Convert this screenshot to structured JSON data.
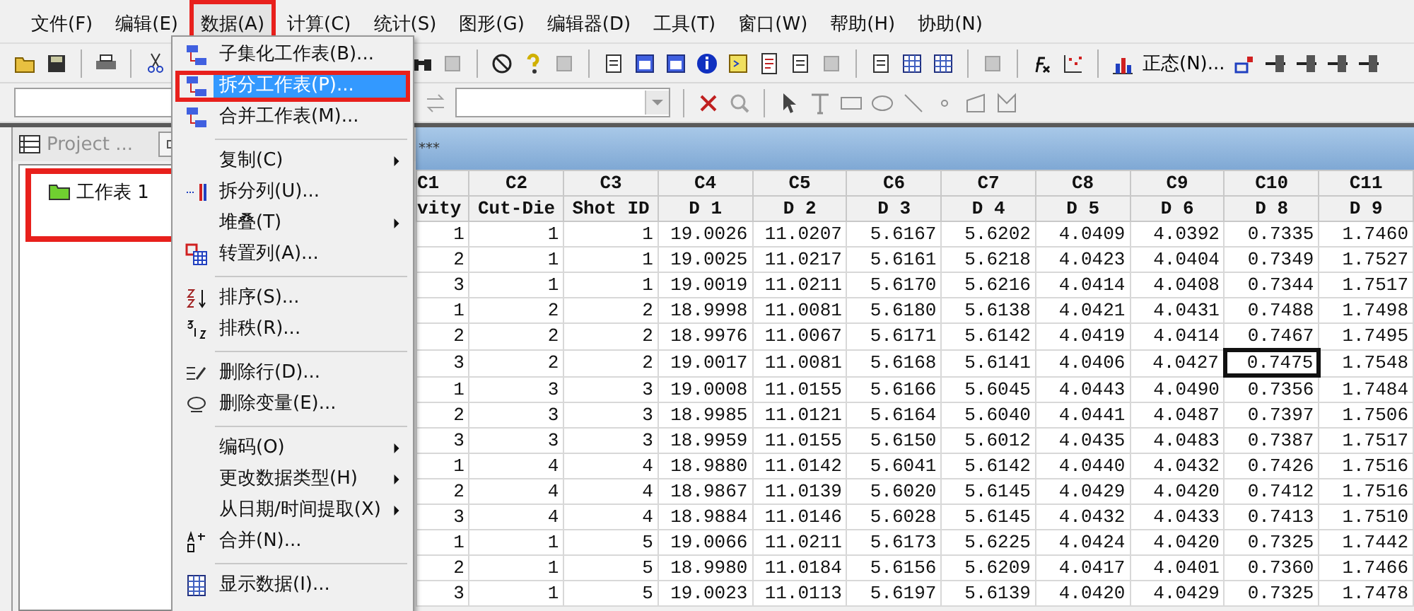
{
  "menu_bar": [
    {
      "label": "文件(F)",
      "selected": false,
      "highlighted": false
    },
    {
      "label": "编辑(E)",
      "selected": false,
      "highlighted": false
    },
    {
      "label": "数据(A)",
      "selected": true,
      "highlighted": true
    },
    {
      "label": "计算(C)",
      "selected": false,
      "highlighted": false
    },
    {
      "label": "统计(S)",
      "selected": false,
      "highlighted": false
    },
    {
      "label": "图形(G)",
      "selected": false,
      "highlighted": false
    },
    {
      "label": "编辑器(D)",
      "selected": false,
      "highlighted": false
    },
    {
      "label": "工具(T)",
      "selected": false,
      "highlighted": false
    },
    {
      "label": "窗口(W)",
      "selected": false,
      "highlighted": false
    },
    {
      "label": "帮助(H)",
      "selected": false,
      "highlighted": false
    },
    {
      "label": "协助(N)",
      "selected": false,
      "highlighted": false
    }
  ],
  "toolbar": {
    "normal_button": "正态(N)..."
  },
  "data_menu": {
    "groups": [
      [
        {
          "label": "子集化工作表(B)...",
          "selected": false,
          "highlighted": false,
          "submenu": false
        },
        {
          "label": "拆分工作表(P)...",
          "selected": true,
          "highlighted": true,
          "submenu": false
        },
        {
          "label": "合并工作表(M)...",
          "selected": false,
          "highlighted": false,
          "submenu": false
        }
      ],
      [
        {
          "label": "复制(C)",
          "selected": false,
          "highlighted": false,
          "submenu": true
        },
        {
          "label": "拆分列(U)...",
          "selected": false,
          "highlighted": false,
          "submenu": false
        },
        {
          "label": "堆叠(T)",
          "selected": false,
          "highlighted": false,
          "submenu": true
        },
        {
          "label": "转置列(A)...",
          "selected": false,
          "highlighted": false,
          "submenu": false
        }
      ],
      [
        {
          "label": "排序(S)...",
          "selected": false,
          "highlighted": false,
          "submenu": false
        },
        {
          "label": "排秩(R)...",
          "selected": false,
          "highlighted": false,
          "submenu": false
        }
      ],
      [
        {
          "label": "删除行(D)...",
          "selected": false,
          "highlighted": false,
          "submenu": false
        },
        {
          "label": "删除变量(E)...",
          "selected": false,
          "highlighted": false,
          "submenu": false
        }
      ],
      [
        {
          "label": "编码(O)",
          "selected": false,
          "highlighted": false,
          "submenu": true
        },
        {
          "label": "更改数据类型(H)",
          "selected": false,
          "highlighted": false,
          "submenu": true
        },
        {
          "label": "从日期/时间提取(X)",
          "selected": false,
          "highlighted": false,
          "submenu": true
        },
        {
          "label": "合并(N)...",
          "selected": false,
          "highlighted": false,
          "submenu": false
        }
      ],
      [
        {
          "label": "显示数据(I)...",
          "selected": false,
          "highlighted": false,
          "submenu": false
        }
      ]
    ]
  },
  "project_window": {
    "title": "Project ...",
    "items": [
      {
        "label": "工作表 1",
        "highlighted": true
      }
    ]
  },
  "worksheet": {
    "title": "***",
    "columns": [
      {
        "id": "C1",
        "name": "vity"
      },
      {
        "id": "C2",
        "name": "Cut-Die"
      },
      {
        "id": "C3",
        "name": "Shot ID"
      },
      {
        "id": "C4",
        "name": "D 1"
      },
      {
        "id": "C5",
        "name": "D 2"
      },
      {
        "id": "C6",
        "name": "D 3"
      },
      {
        "id": "C7",
        "name": "D 4"
      },
      {
        "id": "C8",
        "name": "D 5"
      },
      {
        "id": "C9",
        "name": "D 6"
      },
      {
        "id": "C10",
        "name": "D 8"
      },
      {
        "id": "C11",
        "name": "D 9"
      }
    ],
    "rows": [
      [
        {
          "value": "1",
          "current": false
        },
        {
          "value": "1",
          "current": false
        },
        {
          "value": "1",
          "current": false
        },
        {
          "value": "19.0026",
          "current": false
        },
        {
          "value": "11.0207",
          "current": false
        },
        {
          "value": "5.6167",
          "current": false
        },
        {
          "value": "5.6202",
          "current": false
        },
        {
          "value": "4.0409",
          "current": false
        },
        {
          "value": "4.0392",
          "current": false
        },
        {
          "value": "0.7335",
          "current": false
        },
        {
          "value": "1.7460",
          "current": false
        }
      ],
      [
        {
          "value": "2",
          "current": false
        },
        {
          "value": "1",
          "current": false
        },
        {
          "value": "1",
          "current": false
        },
        {
          "value": "19.0025",
          "current": false
        },
        {
          "value": "11.0217",
          "current": false
        },
        {
          "value": "5.6161",
          "current": false
        },
        {
          "value": "5.6218",
          "current": false
        },
        {
          "value": "4.0423",
          "current": false
        },
        {
          "value": "4.0404",
          "current": false
        },
        {
          "value": "0.7349",
          "current": false
        },
        {
          "value": "1.7527",
          "current": false
        }
      ],
      [
        {
          "value": "3",
          "current": false
        },
        {
          "value": "1",
          "current": false
        },
        {
          "value": "1",
          "current": false
        },
        {
          "value": "19.0019",
          "current": false
        },
        {
          "value": "11.0211",
          "current": false
        },
        {
          "value": "5.6170",
          "current": false
        },
        {
          "value": "5.6216",
          "current": false
        },
        {
          "value": "4.0414",
          "current": false
        },
        {
          "value": "4.0408",
          "current": false
        },
        {
          "value": "0.7344",
          "current": false
        },
        {
          "value": "1.7517",
          "current": false
        }
      ],
      [
        {
          "value": "1",
          "current": false
        },
        {
          "value": "2",
          "current": false
        },
        {
          "value": "2",
          "current": false
        },
        {
          "value": "18.9998",
          "current": false
        },
        {
          "value": "11.0081",
          "current": false
        },
        {
          "value": "5.6180",
          "current": false
        },
        {
          "value": "5.6138",
          "current": false
        },
        {
          "value": "4.0421",
          "current": false
        },
        {
          "value": "4.0431",
          "current": false
        },
        {
          "value": "0.7488",
          "current": false
        },
        {
          "value": "1.7498",
          "current": false
        }
      ],
      [
        {
          "value": "2",
          "current": false
        },
        {
          "value": "2",
          "current": false
        },
        {
          "value": "2",
          "current": false
        },
        {
          "value": "18.9976",
          "current": false
        },
        {
          "value": "11.0067",
          "current": false
        },
        {
          "value": "5.6171",
          "current": false
        },
        {
          "value": "5.6142",
          "current": false
        },
        {
          "value": "4.0419",
          "current": false
        },
        {
          "value": "4.0414",
          "current": false
        },
        {
          "value": "0.7467",
          "current": false
        },
        {
          "value": "1.7495",
          "current": false
        }
      ],
      [
        {
          "value": "3",
          "current": false
        },
        {
          "value": "2",
          "current": false
        },
        {
          "value": "2",
          "current": false
        },
        {
          "value": "19.0017",
          "current": false
        },
        {
          "value": "11.0081",
          "current": false
        },
        {
          "value": "5.6168",
          "current": false
        },
        {
          "value": "5.6141",
          "current": false
        },
        {
          "value": "4.0406",
          "current": false
        },
        {
          "value": "4.0427",
          "current": false
        },
        {
          "value": "0.7475",
          "current": true
        },
        {
          "value": "1.7548",
          "current": false
        }
      ],
      [
        {
          "value": "1",
          "current": false
        },
        {
          "value": "3",
          "current": false
        },
        {
          "value": "3",
          "current": false
        },
        {
          "value": "19.0008",
          "current": false
        },
        {
          "value": "11.0155",
          "current": false
        },
        {
          "value": "5.6166",
          "current": false
        },
        {
          "value": "5.6045",
          "current": false
        },
        {
          "value": "4.0443",
          "current": false
        },
        {
          "value": "4.0490",
          "current": false
        },
        {
          "value": "0.7356",
          "current": false
        },
        {
          "value": "1.7484",
          "current": false
        }
      ],
      [
        {
          "value": "2",
          "current": false
        },
        {
          "value": "3",
          "current": false
        },
        {
          "value": "3",
          "current": false
        },
        {
          "value": "18.9985",
          "current": false
        },
        {
          "value": "11.0121",
          "current": false
        },
        {
          "value": "5.6164",
          "current": false
        },
        {
          "value": "5.6040",
          "current": false
        },
        {
          "value": "4.0441",
          "current": false
        },
        {
          "value": "4.0487",
          "current": false
        },
        {
          "value": "0.7397",
          "current": false
        },
        {
          "value": "1.7506",
          "current": false
        }
      ],
      [
        {
          "value": "3",
          "current": false
        },
        {
          "value": "3",
          "current": false
        },
        {
          "value": "3",
          "current": false
        },
        {
          "value": "18.9959",
          "current": false
        },
        {
          "value": "11.0155",
          "current": false
        },
        {
          "value": "5.6150",
          "current": false
        },
        {
          "value": "5.6012",
          "current": false
        },
        {
          "value": "4.0435",
          "current": false
        },
        {
          "value": "4.0483",
          "current": false
        },
        {
          "value": "0.7387",
          "current": false
        },
        {
          "value": "1.7517",
          "current": false
        }
      ],
      [
        {
          "value": "1",
          "current": false
        },
        {
          "value": "4",
          "current": false
        },
        {
          "value": "4",
          "current": false
        },
        {
          "value": "18.9880",
          "current": false
        },
        {
          "value": "11.0142",
          "current": false
        },
        {
          "value": "5.6041",
          "current": false
        },
        {
          "value": "5.6142",
          "current": false
        },
        {
          "value": "4.0440",
          "current": false
        },
        {
          "value": "4.0432",
          "current": false
        },
        {
          "value": "0.7426",
          "current": false
        },
        {
          "value": "1.7516",
          "current": false
        }
      ],
      [
        {
          "value": "2",
          "current": false
        },
        {
          "value": "4",
          "current": false
        },
        {
          "value": "4",
          "current": false
        },
        {
          "value": "18.9867",
          "current": false
        },
        {
          "value": "11.0139",
          "current": false
        },
        {
          "value": "5.6020",
          "current": false
        },
        {
          "value": "5.6145",
          "current": false
        },
        {
          "value": "4.0429",
          "current": false
        },
        {
          "value": "4.0420",
          "current": false
        },
        {
          "value": "0.7412",
          "current": false
        },
        {
          "value": "1.7516",
          "current": false
        }
      ],
      [
        {
          "value": "3",
          "current": false
        },
        {
          "value": "4",
          "current": false
        },
        {
          "value": "4",
          "current": false
        },
        {
          "value": "18.9884",
          "current": false
        },
        {
          "value": "11.0146",
          "current": false
        },
        {
          "value": "5.6028",
          "current": false
        },
        {
          "value": "5.6145",
          "current": false
        },
        {
          "value": "4.0432",
          "current": false
        },
        {
          "value": "4.0433",
          "current": false
        },
        {
          "value": "0.7413",
          "current": false
        },
        {
          "value": "1.7510",
          "current": false
        }
      ],
      [
        {
          "value": "1",
          "current": false
        },
        {
          "value": "1",
          "current": false
        },
        {
          "value": "5",
          "current": false
        },
        {
          "value": "19.0066",
          "current": false
        },
        {
          "value": "11.0211",
          "current": false
        },
        {
          "value": "5.6173",
          "current": false
        },
        {
          "value": "5.6225",
          "current": false
        },
        {
          "value": "4.0424",
          "current": false
        },
        {
          "value": "4.0420",
          "current": false
        },
        {
          "value": "0.7325",
          "current": false
        },
        {
          "value": "1.7442",
          "current": false
        }
      ],
      [
        {
          "value": "2",
          "current": false
        },
        {
          "value": "1",
          "current": false
        },
        {
          "value": "5",
          "current": false
        },
        {
          "value": "18.9980",
          "current": false
        },
        {
          "value": "11.0184",
          "current": false
        },
        {
          "value": "5.6156",
          "current": false
        },
        {
          "value": "5.6209",
          "current": false
        },
        {
          "value": "4.0417",
          "current": false
        },
        {
          "value": "4.0401",
          "current": false
        },
        {
          "value": "0.7360",
          "current": false
        },
        {
          "value": "1.7466",
          "current": false
        }
      ],
      [
        {
          "value": "3",
          "current": false
        },
        {
          "value": "1",
          "current": false
        },
        {
          "value": "5",
          "current": false
        },
        {
          "value": "19.0023",
          "current": false
        },
        {
          "value": "11.0113",
          "current": false
        },
        {
          "value": "5.6197",
          "current": false
        },
        {
          "value": "5.6139",
          "current": false
        },
        {
          "value": "4.0420",
          "current": false
        },
        {
          "value": "4.0429",
          "current": false
        },
        {
          "value": "0.7325",
          "current": false
        },
        {
          "value": "1.7478",
          "current": false
        }
      ]
    ]
  }
}
